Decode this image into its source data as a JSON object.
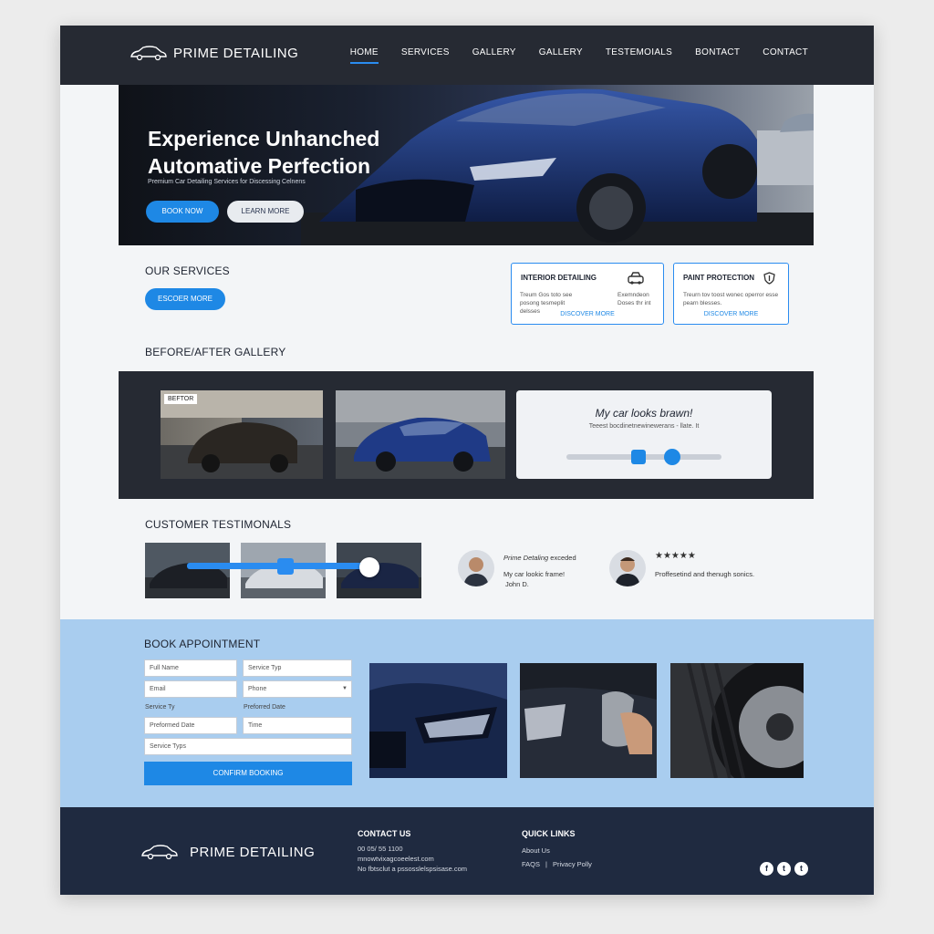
{
  "header": {
    "brand": "PRIME DETAILING",
    "nav": [
      "HOME",
      "SERVICES",
      "GALLERY",
      "GALLERY",
      "TESTEMOIALS",
      "BONTACT",
      "CONTACT"
    ],
    "active_nav": "HOME"
  },
  "hero": {
    "title": "Experience Unhanched Automative Perfection",
    "subtitle": "Premium Car Detailing Services for Discessing Celnens",
    "book_label": "BOOK NOW",
    "learn_label": "LEARN MORE"
  },
  "services": {
    "heading": "OUR SERVICES",
    "button_label": "ESCOER MORE",
    "cards": [
      {
        "title": "INTERIOR DETAILING",
        "desc_left": "Treum Gos toto see posong tesmeplit delsses",
        "desc_right": "Exemndeon Doses thr int",
        "link": "DISCOVER MORE",
        "icon": "car-icon"
      },
      {
        "title": "PAINT PROTECTION",
        "desc": "Treurn tov toost wonec operror esse pearn blesses.",
        "link": "DISCOVER MORE",
        "icon": "shield-icon"
      }
    ]
  },
  "gallery": {
    "heading": "BEFORE/AFTER GALLERY",
    "before_tag": "BEFTOR",
    "review_quote": "My car looks brawn!",
    "review_sub": "Teeest bocdinetnewinewerans - llate. It"
  },
  "testimonials": {
    "heading": "CUSTOMER TESTIMONALS",
    "items": [
      {
        "name": "Prime Detaling",
        "headline": "exceded",
        "quote": "My car lookic frame!",
        "author": "John D."
      },
      {
        "stars": "★★★★★",
        "quote": "Proffesetind and thenugh sonics."
      }
    ]
  },
  "booking": {
    "heading": "BOOK APPOINTMENT",
    "fields": {
      "full_name": "Full Name",
      "service_type_1": "Service Typ",
      "email": "Email",
      "phone": "Phone",
      "service_label": "Service Ty",
      "preferred_label": "Preforred Date",
      "preferred_date": "Preformed Date",
      "time": "Time",
      "service_type_2": "Service Typs"
    },
    "confirm_label": "CONFIRM BOOKING"
  },
  "footer": {
    "brand": "PRIME DETAILING",
    "contact_heading": "CONTACT US",
    "contact_lines": [
      "00 05/ 55 1100",
      "mnowtvixagcoeelest.com",
      "No fbtsclut a pssosslelspsisase.com"
    ],
    "links_heading": "QUICK LINKS",
    "links": [
      "About Us",
      "FAQS",
      "Privacy Polly"
    ],
    "link_separator": "|",
    "social": [
      "f",
      "t",
      "t"
    ]
  },
  "colors": {
    "accent": "#1e88e5",
    "header_bg": "#262a33",
    "booking_bg": "#a9cdef",
    "footer_bg": "#1f2a40"
  }
}
